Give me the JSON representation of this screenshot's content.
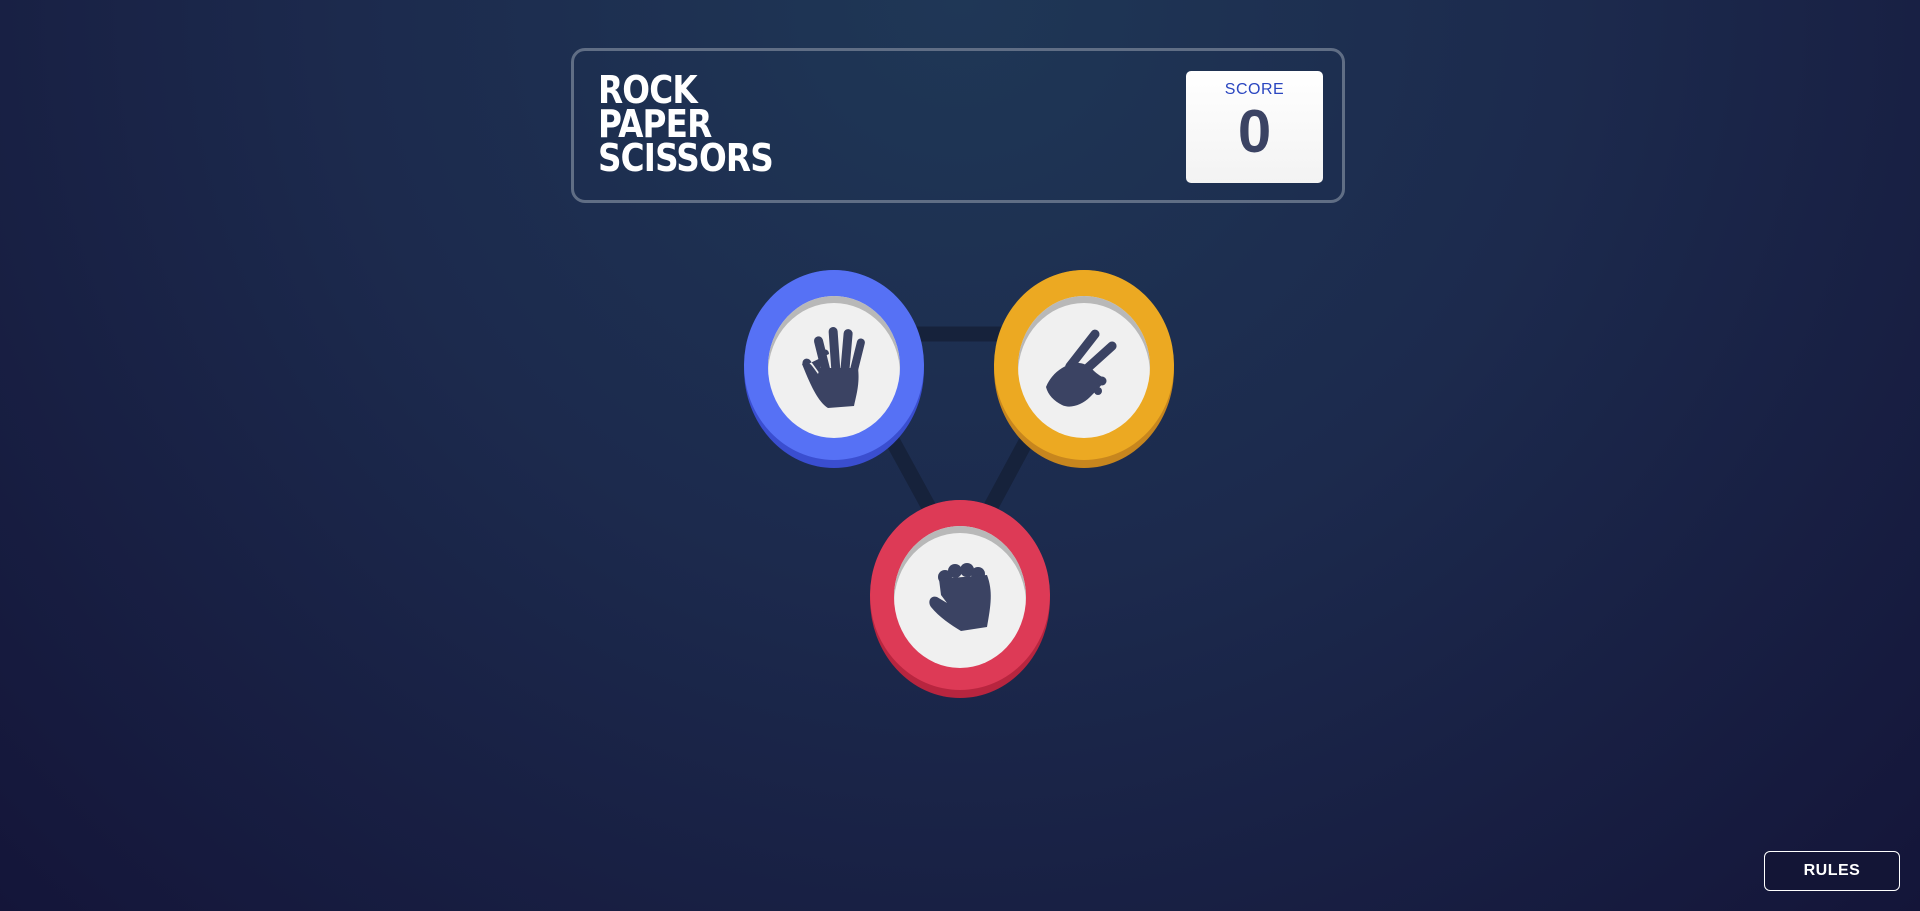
{
  "header": {
    "title_lines": [
      "ROCK",
      "PAPER",
      "SCISSORS"
    ],
    "score_label": "SCORE",
    "score_value": "0"
  },
  "choices": [
    {
      "id": "paper",
      "icon": "hand-paper-icon",
      "color": "#5671f5"
    },
    {
      "id": "scissors",
      "icon": "hand-scissors-icon",
      "color": "#eca922"
    },
    {
      "id": "rock",
      "icon": "hand-rock-icon",
      "color": "#dd3a56"
    }
  ],
  "colors": {
    "icon": "#3b4363",
    "accent": "#2a46c0"
  },
  "footer": {
    "rules_label": "RULES"
  }
}
